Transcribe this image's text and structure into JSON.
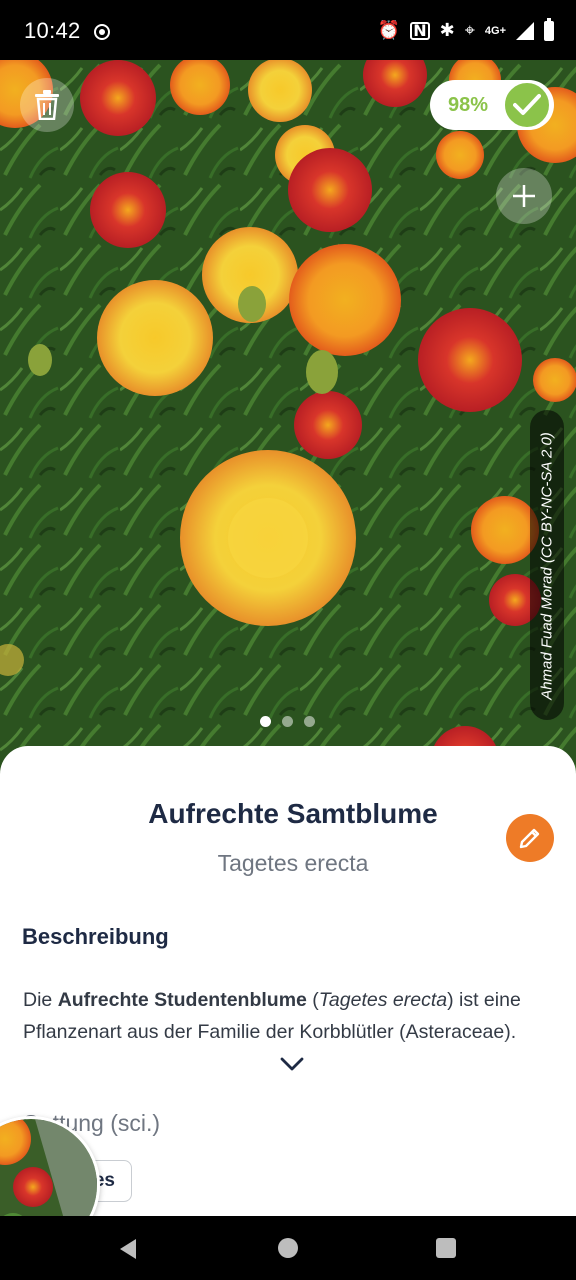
{
  "status_bar": {
    "time": "10:42",
    "network": "4G+"
  },
  "photo": {
    "confidence": "98%",
    "credit": "Ahmad Fuad Morad (CC BY-NC-SA 2.0)",
    "page_count": 3,
    "active_page": 1
  },
  "plant": {
    "common_name": "Aufrechte Samtblume",
    "scientific_name": "Tagetes erecta"
  },
  "description": {
    "heading": "Beschreibung",
    "intro": "Die ",
    "bold_name": "Aufrechte Studentenblume",
    "paren_open": " (",
    "italic_name": "Tagetes erecta",
    "rest": ") ist eine Pflanzenart aus der Familie der Korbblütler (Asteraceae)."
  },
  "genus": {
    "label": "Gattung (sci.)",
    "chip_text": "es"
  },
  "colors": {
    "accent_green": "#8bc34a",
    "edit_orange": "#ee7b27",
    "title_navy": "#1e2a44"
  },
  "icons": {
    "trash": "trash-icon",
    "check": "check-icon",
    "add": "plus-icon",
    "edit": "pencil-icon",
    "expand": "chevron-down-icon"
  }
}
